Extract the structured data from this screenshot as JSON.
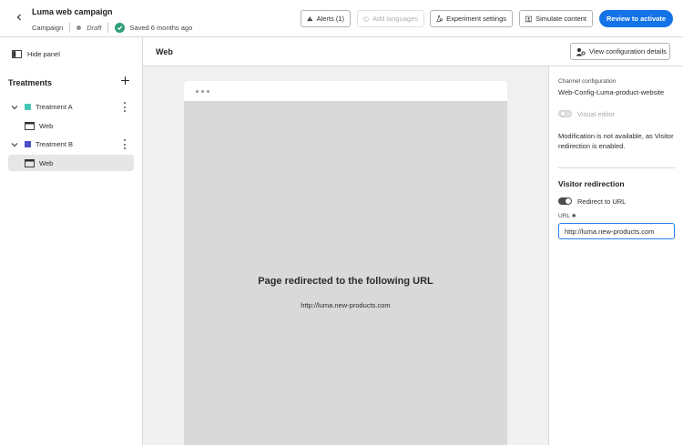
{
  "header": {
    "title": "Luma web campaign",
    "type": "Campaign",
    "status": "Draft",
    "saved": "Saved 6 months ago",
    "buttons": {
      "alerts": "Alerts (1)",
      "add_languages": "Add languages",
      "experiment_settings": "Experiment settings",
      "simulate_content": "Simulate content",
      "review_activate": "Review to activate"
    }
  },
  "left_panel": {
    "hide_panel": "Hide panel",
    "treatments_title": "Treatments",
    "treatments": [
      {
        "label": "Treatment A",
        "color": "#47c6b7",
        "child": "Web"
      },
      {
        "label": "Treatment B",
        "color": "#4c4fc9",
        "child": "Web"
      }
    ]
  },
  "main": {
    "title": "Web",
    "config_button": "View configuration details",
    "redirect_title": "Page redirected to the following URL",
    "redirect_url": "http://luma.new-products.com"
  },
  "right_panel": {
    "channel_label": "Channel configuration",
    "channel_value": "Web-Config-Luma-product-website",
    "visual_editor": "Visual editor",
    "note": "Modification is not available, as Visitor redirection is enabled.",
    "section_title": "Visitor redirection",
    "redirect_toggle": "Redirect to URL",
    "url_label": "URL",
    "url_value": "http://luma.new-products.com"
  },
  "colors": {
    "accent": "#1473e6",
    "success": "#2d9d78"
  }
}
